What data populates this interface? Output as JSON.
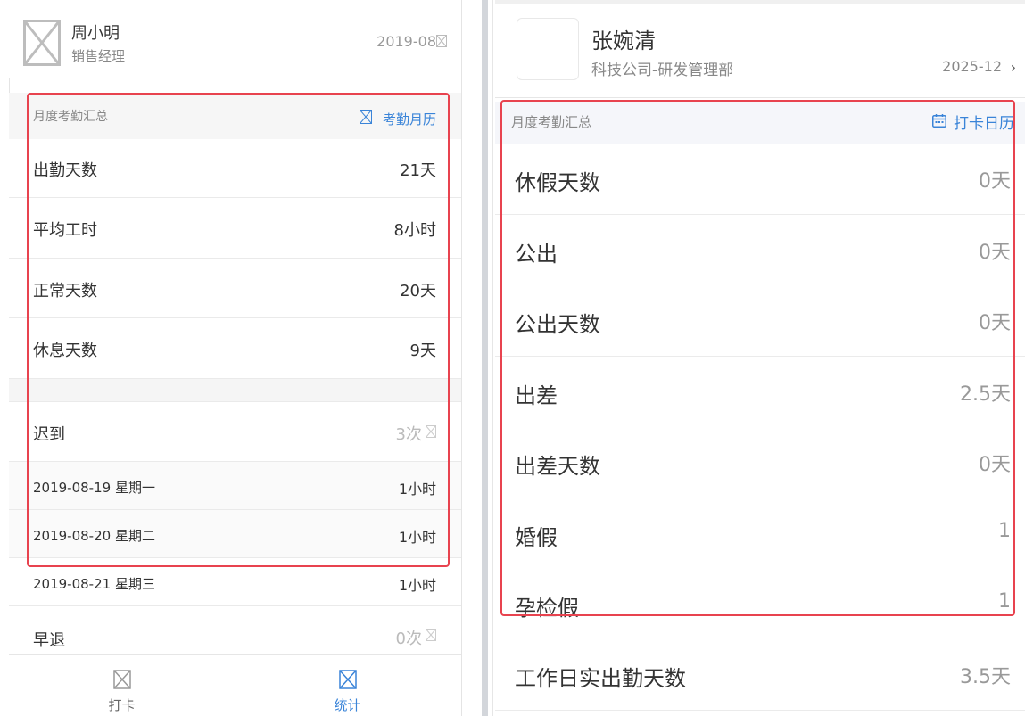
{
  "left": {
    "user": {
      "name": "周小明",
      "title": "销售经理",
      "month": "2019-08"
    },
    "summary": {
      "title": "月度考勤汇总",
      "link_label": "考勤月历",
      "rows": [
        {
          "label": "出勤天数",
          "value": "21天"
        },
        {
          "label": "平均工时",
          "value": "8小时"
        },
        {
          "label": "正常天数",
          "value": "20天"
        },
        {
          "label": "休息天数",
          "value": "9天"
        }
      ]
    },
    "late": {
      "label": "迟到",
      "value": "3次",
      "entries": [
        {
          "date": "2019-08-19  星期一",
          "value": "1小时"
        },
        {
          "date": "2019-08-20  星期二",
          "value": "1小时"
        },
        {
          "date": "2019-08-21  星期三",
          "value": "1小时"
        }
      ]
    },
    "early": {
      "label": "早退",
      "value": "0次"
    },
    "tabs": [
      {
        "label": "打卡",
        "active": false
      },
      {
        "label": "统计",
        "active": true
      }
    ]
  },
  "right": {
    "user": {
      "name": "张婉清",
      "dept": "科技公司-研发管理部",
      "month": "2025-12",
      "chevron": "›"
    },
    "summary": {
      "title": "月度考勤汇总",
      "link_label": "打卡日历",
      "rows": [
        {
          "label": "休假天数",
          "value": "0天"
        },
        {
          "label": "公出",
          "value": "0天"
        },
        {
          "label": "公出天数",
          "value": "0天"
        },
        {
          "label": "出差",
          "value": "2.5天"
        },
        {
          "label": "出差天数",
          "value": "0天"
        },
        {
          "label": "婚假",
          "value": "1"
        },
        {
          "label": "孕检假",
          "value": "1"
        },
        {
          "label": "工作日实出勤天数",
          "value": "3.5天"
        }
      ]
    }
  },
  "colors": {
    "accent": "#3a84d8",
    "highlight": "#e8434f",
    "muted_text": "#999999",
    "section_bg": "#f5f6fa"
  },
  "icons": {
    "placeholder": "broken-image-icon",
    "calendar": "calendar-icon",
    "chevron": "chevron-right-icon"
  }
}
